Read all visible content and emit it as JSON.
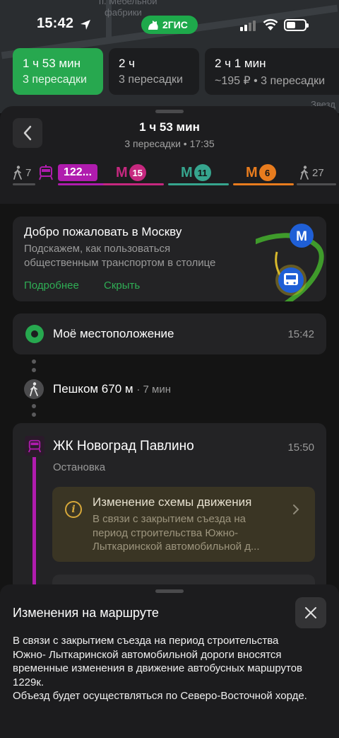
{
  "map": {
    "labels": [
      "п. Мебельной",
      "фабрики"
    ],
    "side_label": "Звезд"
  },
  "status_bar": {
    "time": "15:42",
    "app_badge": "2ГИС"
  },
  "route_options": [
    {
      "time": "1 ч 53 мин",
      "sub": "3 пересадки",
      "active": true
    },
    {
      "time": "2 ч",
      "sub": "3 пересадки",
      "active": false
    },
    {
      "time": "2 ч 1 мин",
      "sub": "~195 ₽ • 3 пересадки",
      "active": false
    }
  ],
  "summary": {
    "title": "1 ч 53 мин",
    "subtitle": "3 пересадки • 17:35"
  },
  "segments": {
    "walk_start": "7",
    "bus": "122...",
    "metro": [
      {
        "letter": "М",
        "line": "15",
        "color": "#c6287f"
      },
      {
        "letter": "М",
        "line": "11",
        "color": "#36a58e"
      },
      {
        "letter": "М",
        "line": "6",
        "color": "#e87c1e"
      }
    ],
    "walk_end": "27",
    "colors": {
      "walk": "#4f4f51",
      "bus": "#b01cae"
    }
  },
  "welcome": {
    "title": "Добро пожаловать в Москву",
    "text": "Подскажем, как пользоваться общественным транспортом в столице",
    "more": "Подробнее",
    "hide": "Скрыть"
  },
  "start": {
    "name": "Моё местоположение",
    "time": "15:42"
  },
  "walk": {
    "label": "Пешком 670 м",
    "duration": "· 7 мин"
  },
  "stop": {
    "name": "ЖК Новоград Павлино",
    "time": "15:50",
    "type": "Остановка",
    "notice": {
      "title": "Изменение схемы движения",
      "text": "В связи с закрытием съезда на период строительства Южно-Лыткаринской автомобильной д..."
    }
  },
  "overlay": {
    "title": "Изменения на маршруте",
    "body_lines": [
      "В связи с закрытием съезда на период строительства",
      "Южно- Лыткаринской автомобильной дороги вносятся",
      "временные изменения в движение автобусных маршрутов",
      "1229к.",
      "Объезд будет осуществляться по Северо-Восточной хорде."
    ]
  }
}
